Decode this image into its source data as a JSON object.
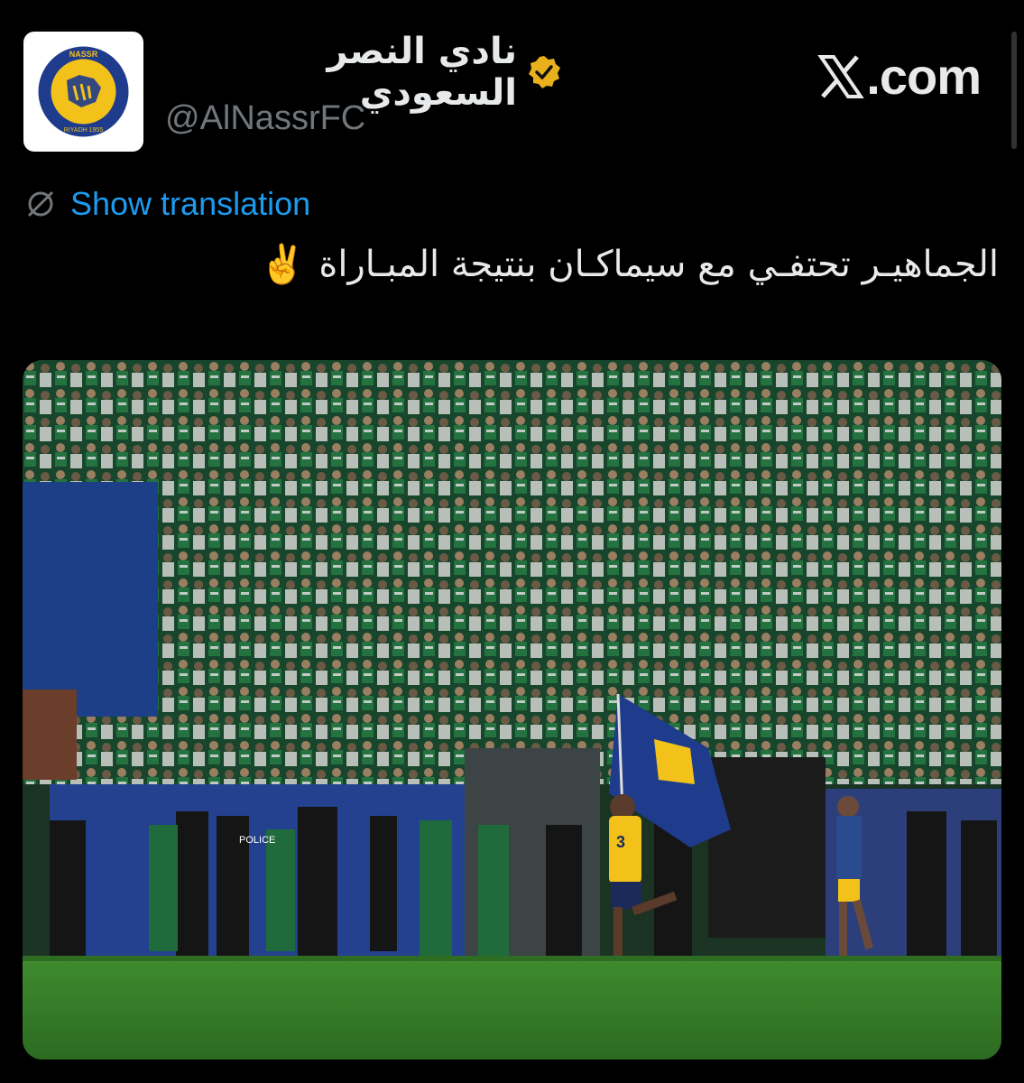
{
  "account": {
    "display_name": "نادي النصر السعودي",
    "handle": "@AlNassrFC",
    "logo_text_top": "NASSR",
    "logo_text_bottom": "RIYADH 1955",
    "verified_color": "#e8b01a"
  },
  "site_label": ".com",
  "translation": {
    "label": "Show translation",
    "icon": "globe-slash-icon"
  },
  "tweet": {
    "text": "الجماهيـر تحتفـي مع سيماكـان بنتيجة المبـاراة",
    "emoji": "✌️"
  },
  "photo": {
    "stand_signage": "POLICE",
    "jersey_number": "3"
  },
  "colors": {
    "accent_link": "#1d9bf0",
    "secondary_text": "#71767b",
    "nassr_yellow": "#f3c21a",
    "nassr_blue": "#1f3b8c",
    "fan_green": "#1f6b3c"
  }
}
